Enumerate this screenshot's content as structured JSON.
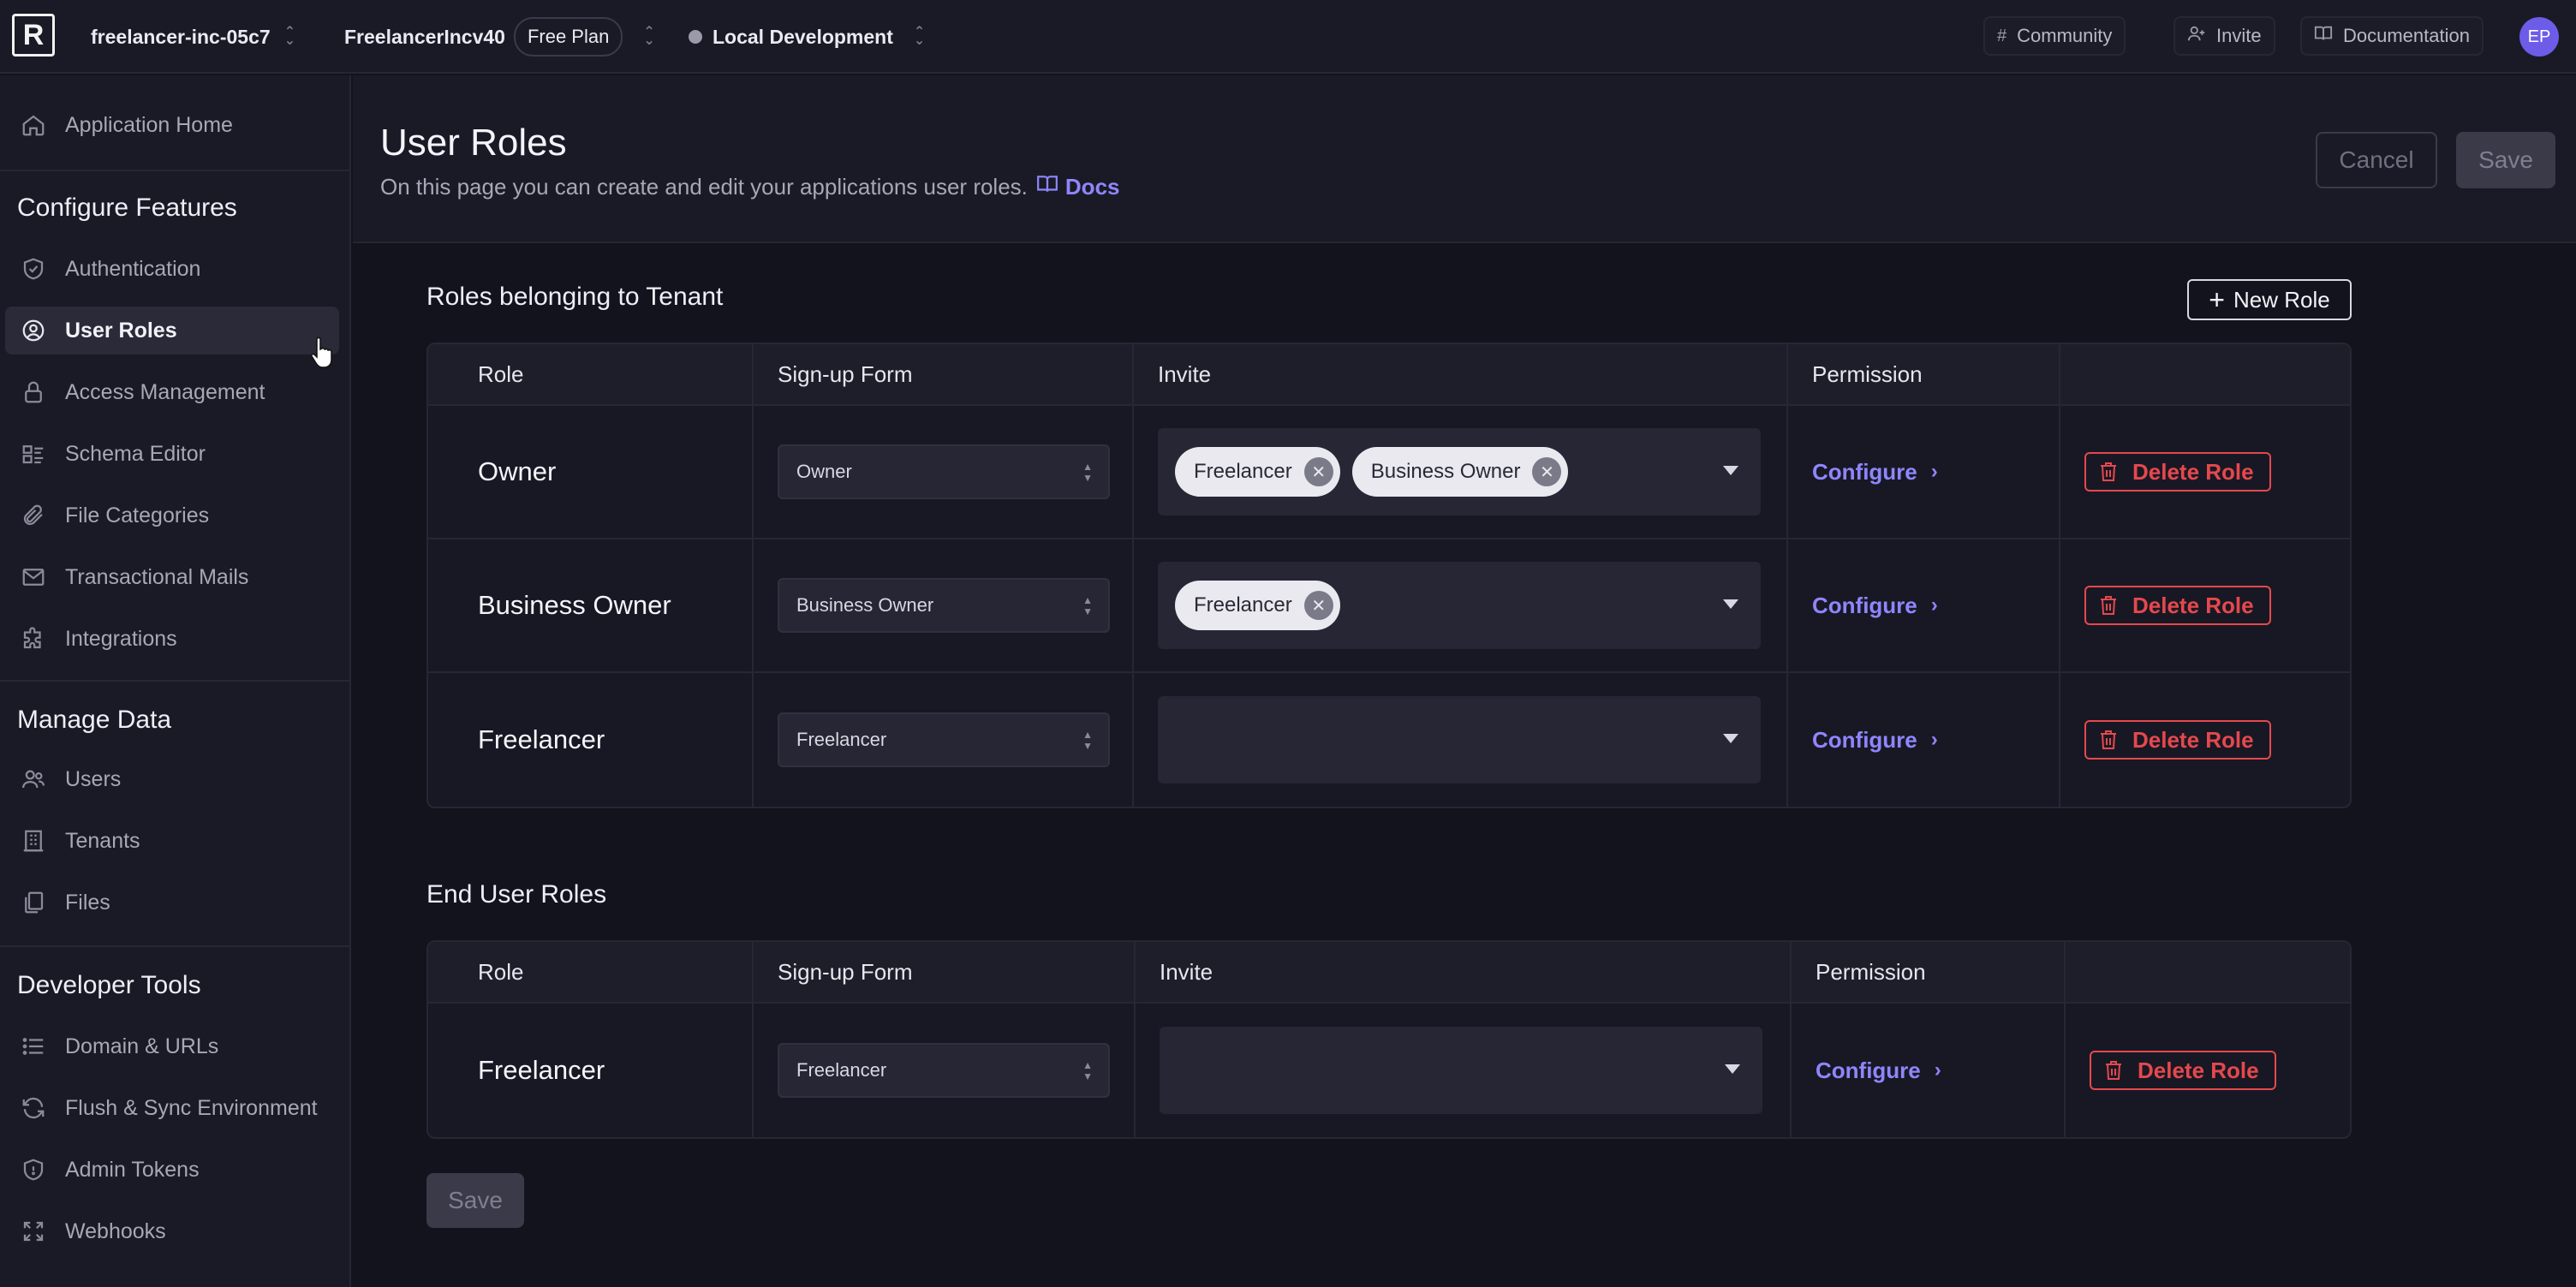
{
  "topbar": {
    "logo_letter": "R",
    "workspace": "freelancer-inc-05c7",
    "app_name": "FreelancerIncv40",
    "plan": "Free Plan",
    "environment": "Local Development",
    "community": "Community",
    "invite": "Invite",
    "documentation": "Documentation",
    "avatar_initials": "EP"
  },
  "sidebar": {
    "home": "Application Home",
    "configure_heading": "Configure Features",
    "configure_items": [
      "Authentication",
      "User Roles",
      "Access Management",
      "Schema Editor",
      "File Categories",
      "Transactional Mails",
      "Integrations"
    ],
    "manage_heading": "Manage Data",
    "manage_items": [
      "Users",
      "Tenants",
      "Files"
    ],
    "dev_heading": "Developer Tools",
    "dev_items": [
      "Domain & URLs",
      "Flush & Sync Environment",
      "Admin Tokens",
      "Webhooks"
    ],
    "active_item": "User Roles"
  },
  "header": {
    "title": "User Roles",
    "subtitle": "On this page you can create and edit your applications user roles.",
    "docs_link": "Docs",
    "cancel": "Cancel",
    "save": "Save"
  },
  "columns": {
    "role": "Role",
    "signup": "Sign-up Form",
    "invite": "Invite",
    "permission": "Permission"
  },
  "tenant_section": {
    "title": "Roles belonging to Tenant",
    "new_role": "New Role",
    "rows": [
      {
        "role": "Owner",
        "signup": "Owner",
        "invite": [
          "Freelancer",
          "Business Owner"
        ],
        "configure": "Configure",
        "delete": "Delete Role"
      },
      {
        "role": "Business Owner",
        "signup": "Business Owner",
        "invite": [
          "Freelancer"
        ],
        "configure": "Configure",
        "delete": "Delete Role"
      },
      {
        "role": "Freelancer",
        "signup": "Freelancer",
        "invite": [],
        "configure": "Configure",
        "delete": "Delete Role"
      }
    ]
  },
  "end_user_section": {
    "title": "End User Roles",
    "rows": [
      {
        "role": "Freelancer",
        "signup": "Freelancer",
        "invite": [],
        "configure": "Configure",
        "delete": "Delete Role"
      }
    ]
  },
  "footer": {
    "save": "Save"
  },
  "colors": {
    "accent": "#8f86ff",
    "danger": "#e5484d",
    "background": "#13131d",
    "panel": "#1a1a26"
  }
}
